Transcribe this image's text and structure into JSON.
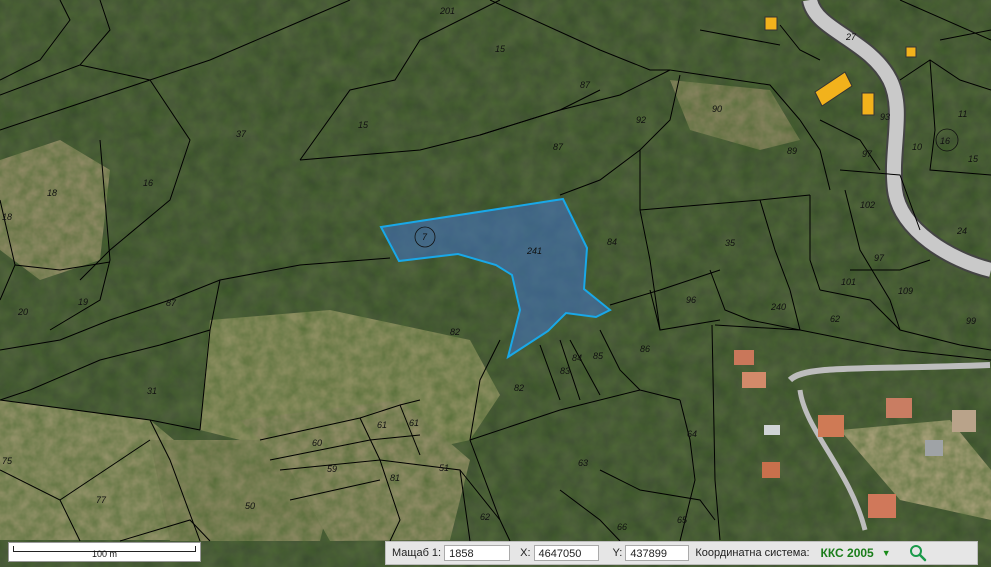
{
  "map": {
    "type": "cadastral-satellite",
    "selected_parcel": {
      "labels": [
        "7",
        "241"
      ]
    },
    "parcel_labels": [
      "201",
      "15",
      "87",
      "37",
      "15",
      "16",
      "18",
      "18",
      "19",
      "20",
      "87",
      "31",
      "82",
      "241",
      "7",
      "84",
      "35",
      "96",
      "240",
      "62",
      "86",
      "97",
      "101",
      "109",
      "92",
      "90",
      "89",
      "83",
      "84",
      "85",
      "82",
      "61",
      "60",
      "59",
      "81",
      "61",
      "51",
      "62",
      "66",
      "65",
      "64",
      "63",
      "77",
      "50",
      "75",
      "27",
      "11",
      "16",
      "15",
      "10",
      "24",
      "99",
      "93",
      "97",
      "102",
      "87"
    ]
  },
  "scale_bar": {
    "label": "100 m"
  },
  "info_bar": {
    "scale_label": "Мащаб 1:",
    "scale_value": "1858",
    "x_label": "X:",
    "x_value": "4647050",
    "y_label": "Y:",
    "y_value": "437899",
    "crs_label": "Координатна система:",
    "crs_value": "ККС 2005"
  },
  "icons": {
    "crs_dropdown": "triangle-down-icon",
    "search": "magnifier-icon"
  },
  "colors": {
    "parcel_lines": "#000000",
    "selection_stroke": "#19a8e8",
    "selection_fill": "#3f73c8",
    "crs_text": "#1a7d1a"
  }
}
